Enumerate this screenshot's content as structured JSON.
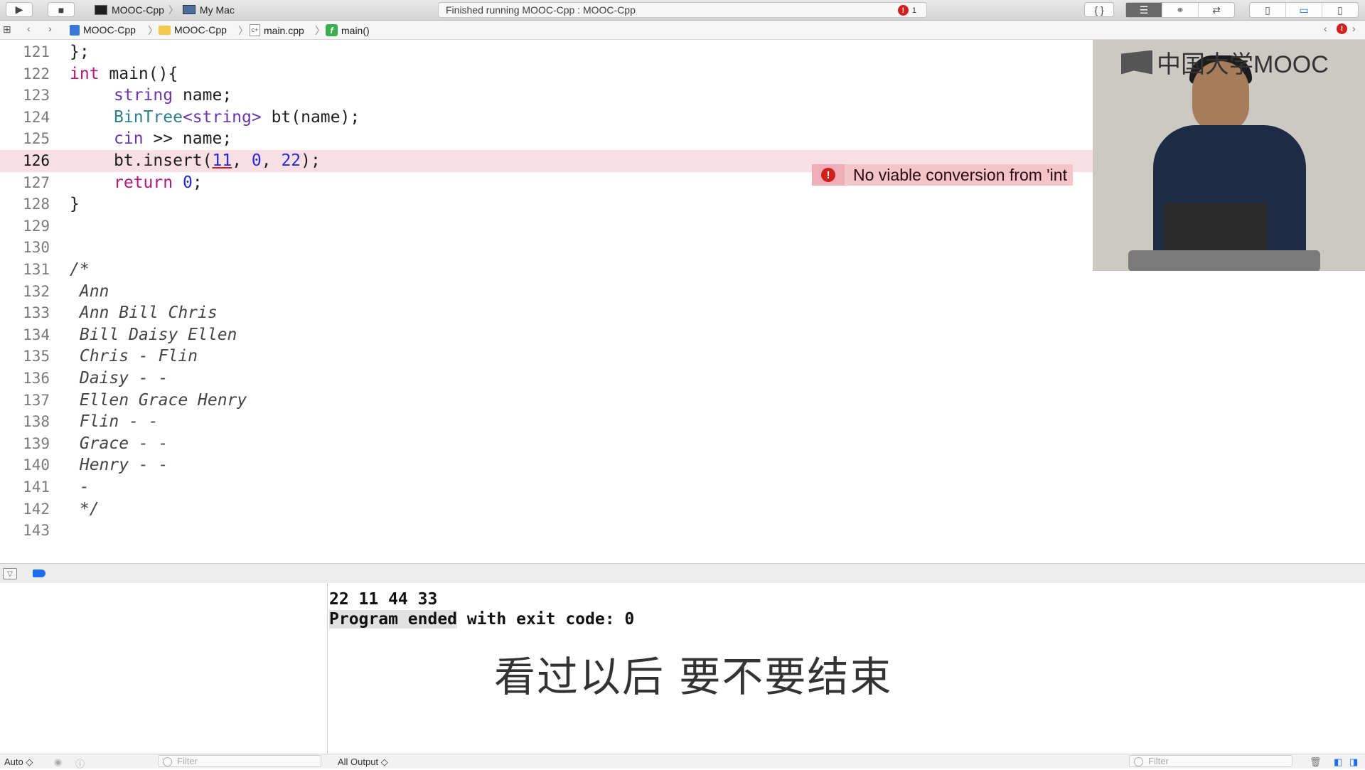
{
  "toolbar": {
    "scheme_name": "MOOC-Cpp",
    "destination": "My Mac",
    "status_text": "Finished running MOOC-Cpp : MOOC-Cpp",
    "error_count": "1",
    "run_icon": "play-icon",
    "stop_icon": "stop-icon"
  },
  "jumpbar": {
    "project": "MOOC-Cpp",
    "group": "MOOC-Cpp",
    "file": "main.cpp",
    "symbol": "main()"
  },
  "editor": {
    "error_message": "No viable conversion from 'int",
    "lines": [
      {
        "n": "121"
      },
      {
        "n": "122"
      },
      {
        "n": "123"
      },
      {
        "n": "124"
      },
      {
        "n": "125"
      },
      {
        "n": "126"
      },
      {
        "n": "127"
      },
      {
        "n": "128"
      },
      {
        "n": "129"
      },
      {
        "n": "130"
      },
      {
        "n": "131"
      },
      {
        "n": "132"
      },
      {
        "n": "133"
      },
      {
        "n": "134"
      },
      {
        "n": "135"
      },
      {
        "n": "136"
      },
      {
        "n": "137"
      },
      {
        "n": "138"
      },
      {
        "n": "139"
      },
      {
        "n": "140"
      },
      {
        "n": "141"
      },
      {
        "n": "142"
      },
      {
        "n": "143"
      }
    ],
    "code": {
      "l121": "};",
      "l122_kw": "int",
      "l122_rest": " main(){",
      "l123_ty": "string",
      "l123_rest": " name;",
      "l124_ty": "BinTree",
      "l124_ty2": "<string>",
      "l124_rest": " bt(name);",
      "l125_kw": "cin",
      "l125_rest": " >> name;",
      "l126_a": "bt.insert(",
      "l126_n1": "11",
      "l126_b": ", ",
      "l126_n2": "0",
      "l126_c": ", ",
      "l126_n3": "22",
      "l126_d": ");",
      "l127_kw": "return",
      "l127_sp": " ",
      "l127_n": "0",
      "l127_rest": ";",
      "l128": "}",
      "l131": "/*",
      "l132": " Ann",
      "l133": " Ann Bill Chris",
      "l134": " Bill Daisy Ellen",
      "l135": " Chris - Flin",
      "l136": " Daisy - -",
      "l137": " Ellen Grace Henry",
      "l138": " Flin - -",
      "l139": " Grace - -",
      "l140": " Henry - -",
      "l141": " -",
      "l142": " */"
    }
  },
  "video": {
    "logo_text": "中国大学MOOC"
  },
  "console": {
    "line1": "22 11 44 33",
    "line2_sel": "Program ended",
    "line2_rest": " with exit code: 0",
    "subtitle": "看过以后 要不要结束"
  },
  "footer": {
    "auto_label": "Auto ◇",
    "filter_left": "Filter",
    "output_label": "All Output ◇",
    "filter_right": "Filter"
  }
}
